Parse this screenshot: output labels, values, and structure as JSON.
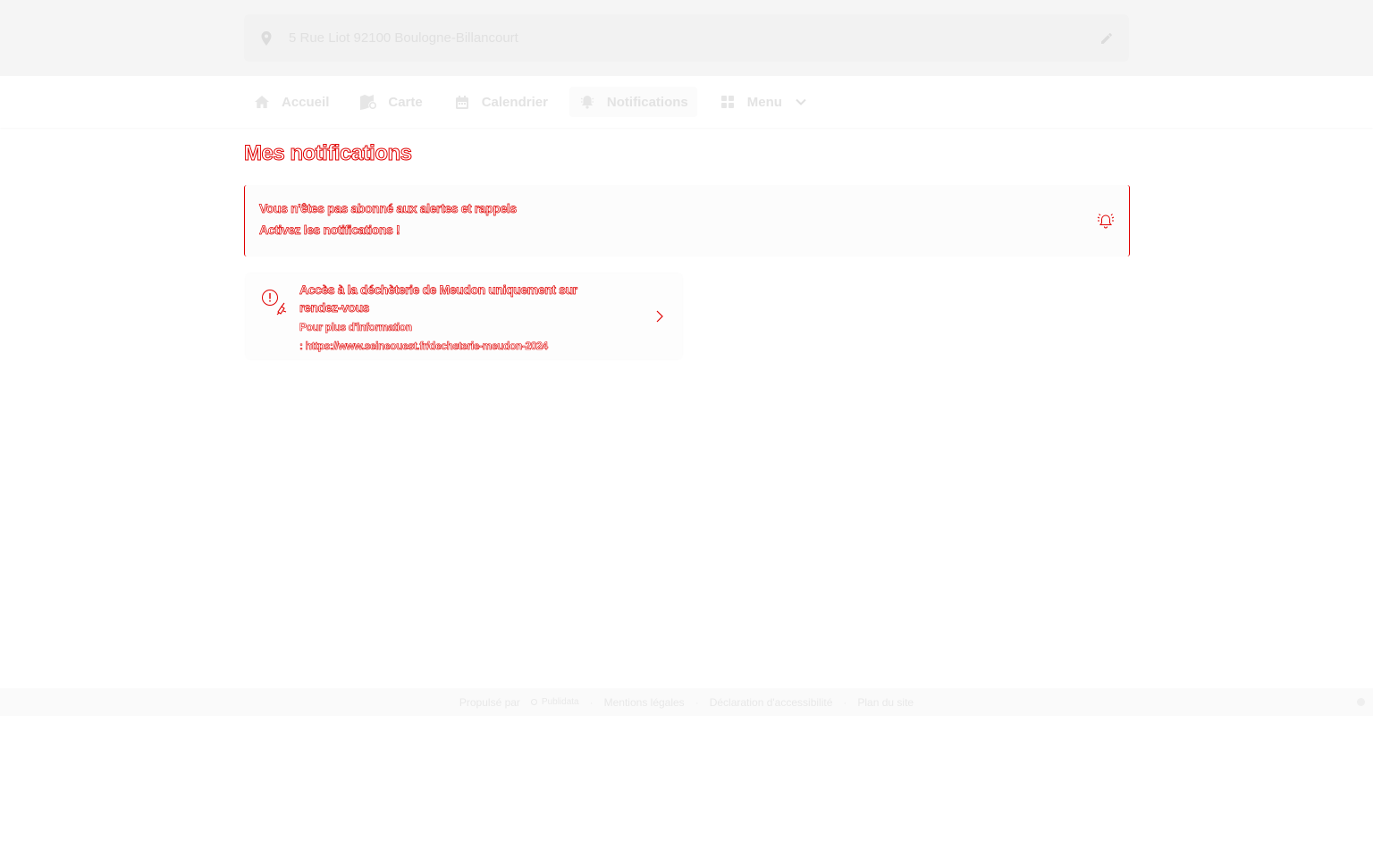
{
  "header": {
    "address": "5 Rue Liot 92100 Boulogne-Billancourt",
    "icons": {
      "location": "location-pin-icon",
      "edit": "pencil-icon"
    }
  },
  "nav": {
    "items": [
      {
        "label": "Accueil",
        "icon": "home-icon"
      },
      {
        "label": "Carte",
        "icon": "map-icon"
      },
      {
        "label": "Calendrier",
        "icon": "calendar-icon"
      },
      {
        "label": "Notifications",
        "icon": "bell-icon",
        "active": true
      },
      {
        "label": "Menu",
        "icon": "grid-icon",
        "has_dropdown": true
      }
    ]
  },
  "main": {
    "title": "Mes notifications",
    "alert": {
      "line1": "Vous n'êtes pas abonné aux alertes et rappels",
      "line2": "Activez les notifications !",
      "icon": "bell-ringing-icon"
    },
    "notifications": [
      {
        "title": "Accès à la déchèterie de Meudon uniquement sur rendez-vous",
        "body_line1": "Pour plus d'information",
        "body_line2": ": https://www.seineouest.fr/decheterie-meudon-2024",
        "icon": "alert-truck-icon"
      }
    ]
  },
  "footer": {
    "powered_by": "Propulsé par",
    "brand": "Publidata",
    "links": [
      "Mentions légales",
      "Déclaration d'accessibilité",
      "Plan du site"
    ],
    "separator": "·"
  },
  "colors": {
    "accent": "#e00000",
    "header_bg": "#f5f5f5",
    "muted_text": "#e3e3e3"
  }
}
